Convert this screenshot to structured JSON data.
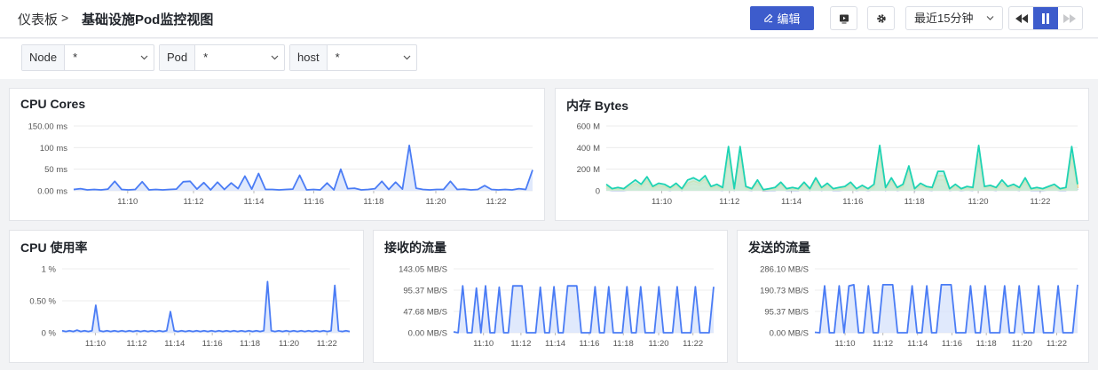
{
  "breadcrumb": {
    "root": "仪表板",
    "separator": ">",
    "title": "基础设施Pod监控视图"
  },
  "toolbar": {
    "edit_label": "编辑",
    "time_range": "最近15分钟"
  },
  "filters": [
    {
      "label": "Node",
      "value": "*"
    },
    {
      "label": "Pod",
      "value": "*"
    },
    {
      "label": "host",
      "value": "*"
    }
  ],
  "colors": {
    "accent": "#3d5ccc",
    "series_blue": "#4a7cf5",
    "fill_blue": "#d6e1fb",
    "mem_teal": "#1ed3b4",
    "mem_yellow": "#f2c94c",
    "mem_orange": "#f5a33b",
    "mem_blue": "#5b7bd5"
  },
  "panels": [
    {
      "title": "CPU Cores",
      "chart_data": {
        "type": "area",
        "y_ticks": [
          "150.00 ms",
          "100 ms",
          "50 ms",
          "0.00 ms"
        ],
        "x_ticks": [
          "11:10",
          "11:12",
          "11:14",
          "11:16",
          "11:18",
          "11:20",
          "11:22"
        ],
        "ylim": [
          0,
          150
        ],
        "series": [
          {
            "values": [
              3,
              5,
              2,
              3,
              2,
              4,
              22,
              3,
              2,
              3,
              21,
              2,
              3,
              2,
              3,
              4,
              21,
              22,
              4,
              19,
              2,
              20,
              3,
              18,
              5,
              34,
              4,
              40,
              3,
              3,
              2,
              3,
              4,
              36,
              2,
              3,
              2,
              18,
              2,
              50,
              5,
              6,
              2,
              3,
              5,
              22,
              3,
              20,
              4,
              105,
              6,
              3,
              2,
              3,
              3,
              22,
              3,
              4,
              2,
              3,
              12,
              3,
              2,
              3,
              2,
              5,
              3,
              48
            ]
          }
        ],
        "grid": true
      }
    },
    {
      "title": "内存 Bytes",
      "chart_data": {
        "type": "area",
        "y_ticks": [
          "600 M",
          "400 M",
          "200 M",
          "0"
        ],
        "x_ticks": [
          "11:10",
          "11:12",
          "11:14",
          "11:16",
          "11:18",
          "11:20",
          "11:22"
        ],
        "ylim": [
          0,
          600
        ],
        "series": [
          {
            "values": [
              60,
              20,
              30,
              20,
              60,
              100,
              60,
              130,
              40,
              70,
              60,
              30,
              70,
              20,
              100,
              120,
              90,
              140,
              40,
              60,
              30,
              410,
              20,
              410,
              40,
              20,
              100,
              10,
              20,
              30,
              80,
              20,
              30,
              20,
              80,
              20,
              120,
              30,
              70,
              20,
              30,
              40,
              80,
              20,
              50,
              20,
              60,
              420,
              30,
              120,
              30,
              60,
              230,
              20,
              70,
              40,
              30,
              180,
              180,
              20,
              60,
              20,
              40,
              30,
              420,
              40,
              50,
              30,
              100,
              40,
              60,
              30,
              120,
              20,
              30,
              20,
              40,
              60,
              20,
              30,
              410,
              60
            ]
          },
          {
            "values": [
              40,
              15,
              20,
              15,
              40,
              70,
              40,
              100,
              30,
              50,
              40,
              20,
              50,
              15,
              70,
              90,
              70,
              110,
              30,
              40,
              20,
              330,
              15,
              330,
              30,
              15,
              70,
              8,
              15,
              20,
              60,
              15,
              20,
              15,
              60,
              15,
              90,
              20,
              50,
              15,
              20,
              30,
              60,
              15,
              40,
              15,
              40,
              340,
              20,
              90,
              20,
              40,
              190,
              15,
              50,
              30,
              20,
              140,
              140,
              15,
              40,
              15,
              30,
              20,
              330,
              30,
              40,
              20,
              70,
              30,
              40,
              20,
              90,
              15,
              20,
              15,
              30,
              40,
              15,
              20,
              330,
              40
            ]
          },
          {
            "values": [
              25,
              10,
              12,
              10,
              25,
              50,
              25,
              70,
              18,
              35,
              25,
              12,
              35,
              10,
              50,
              65,
              50,
              80,
              18,
              25,
              12,
              260,
              10,
              260,
              18,
              10,
              50,
              5,
              10,
              12,
              40,
              10,
              12,
              10,
              40,
              10,
              65,
              12,
              35,
              10,
              12,
              18,
              40,
              10,
              25,
              10,
              25,
              270,
              12,
              65,
              12,
              25,
              150,
              10,
              35,
              18,
              12,
              100,
              100,
              10,
              25,
              10,
              18,
              12,
              260,
              18,
              25,
              12,
              50,
              18,
              25,
              12,
              65,
              10,
              12,
              10,
              18,
              25,
              10,
              12,
              260,
              25
            ]
          },
          {
            "values": [
              10,
              5,
              5,
              5,
              10,
              20,
              10,
              30,
              8,
              15,
              10,
              5,
              15,
              5,
              20,
              25,
              20,
              30,
              8,
              10,
              5,
              80,
              5,
              80,
              8,
              5,
              20,
              3,
              5,
              5,
              15,
              5,
              5,
              5,
              15,
              5,
              25,
              5,
              15,
              5,
              5,
              8,
              15,
              5,
              10,
              5,
              10,
              90,
              5,
              25,
              5,
              10,
              60,
              5,
              15,
              8,
              5,
              40,
              40,
              5,
              10,
              5,
              8,
              5,
              80,
              8,
              10,
              5,
              20,
              8,
              10,
              5,
              25,
              5,
              5,
              5,
              8,
              10,
              5,
              5,
              80,
              10
            ]
          }
        ],
        "grid": true
      }
    },
    {
      "title": "CPU 使用率",
      "chart_data": {
        "type": "area",
        "y_ticks": [
          "1 %",
          "0.50 %",
          "0 %"
        ],
        "x_ticks": [
          "11:10",
          "11:12",
          "11:14",
          "11:16",
          "11:18",
          "11:20",
          "11:22"
        ],
        "ylim": [
          0,
          1
        ],
        "series": [
          {
            "values": [
              0.03,
              0.02,
              0.03,
              0.02,
              0.04,
              0.02,
              0.03,
              0.02,
              0.03,
              0.43,
              0.03,
              0.02,
              0.03,
              0.02,
              0.03,
              0.02,
              0.03,
              0.02,
              0.03,
              0.02,
              0.03,
              0.02,
              0.03,
              0.02,
              0.03,
              0.02,
              0.03,
              0.02,
              0.03,
              0.33,
              0.03,
              0.02,
              0.03,
              0.02,
              0.03,
              0.02,
              0.03,
              0.02,
              0.03,
              0.02,
              0.03,
              0.02,
              0.03,
              0.02,
              0.03,
              0.02,
              0.03,
              0.02,
              0.03,
              0.02,
              0.03,
              0.02,
              0.03,
              0.02,
              0.03,
              0.8,
              0.03,
              0.02,
              0.03,
              0.02,
              0.03,
              0.02,
              0.03,
              0.02,
              0.03,
              0.02,
              0.03,
              0.02,
              0.03,
              0.02,
              0.03,
              0.02,
              0.03,
              0.74,
              0.03,
              0.02,
              0.03,
              0.02
            ]
          }
        ],
        "grid": true
      }
    },
    {
      "title": "接收的流量",
      "chart_data": {
        "type": "area",
        "y_ticks": [
          "143.05 MB/S",
          "95.37 MB/S",
          "47.68 MB/S",
          "0.00 MB/S"
        ],
        "x_ticks": [
          "11:10",
          "11:12",
          "11:14",
          "11:16",
          "11:18",
          "11:20",
          "11:22"
        ],
        "ylim": [
          0,
          143.05
        ],
        "series": [
          {
            "values": [
              2,
              0,
              105,
              0,
              0,
              100,
              0,
              105,
              0,
              0,
              102,
              0,
              0,
              105,
              105,
              105,
              0,
              0,
              0,
              102,
              0,
              0,
              103,
              0,
              0,
              105,
              105,
              105,
              0,
              0,
              0,
              103,
              0,
              0,
              103,
              0,
              0,
              0,
              103,
              0,
              0,
              103,
              0,
              0,
              0,
              103,
              0,
              0,
              0,
              103,
              0,
              0,
              0,
              103,
              0,
              0,
              0,
              103
            ]
          }
        ],
        "grid": true
      }
    },
    {
      "title": "发送的流量",
      "chart_data": {
        "type": "area",
        "y_ticks": [
          "286.10 MB/S",
          "190.73 MB/S",
          "95.37 MB/S",
          "0.00 MB/S"
        ],
        "x_ticks": [
          "11:10",
          "11:12",
          "11:14",
          "11:16",
          "11:18",
          "11:20",
          "11:22"
        ],
        "ylim": [
          0,
          286.1
        ],
        "series": [
          {
            "values": [
              2,
              0,
              210,
              0,
              0,
              210,
              0,
              210,
              215,
              0,
              0,
              210,
              0,
              0,
              215,
              215,
              215,
              0,
              0,
              0,
              210,
              0,
              0,
              210,
              0,
              0,
              215,
              215,
              215,
              0,
              0,
              0,
              210,
              0,
              0,
              210,
              0,
              0,
              0,
              210,
              0,
              0,
              210,
              0,
              0,
              0,
              210,
              0,
              0,
              0,
              210,
              0,
              0,
              0,
              215
            ]
          }
        ],
        "grid": true
      }
    }
  ]
}
